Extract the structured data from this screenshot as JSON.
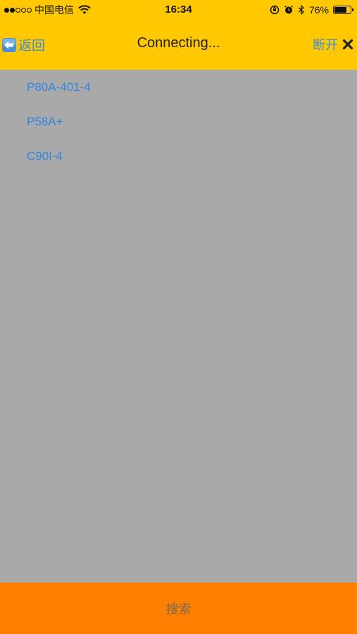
{
  "status_bar": {
    "carrier": "中国电信",
    "time": "16:34",
    "battery_percent": "76%",
    "battery_level": 0.76,
    "icons": [
      "signal-dots",
      "wifi-icon",
      "orientation-lock-icon",
      "alarm-icon",
      "bluetooth-icon",
      "battery-icon"
    ]
  },
  "nav": {
    "back_label": "返回",
    "title": "Connecting...",
    "disconnect_label": "断开"
  },
  "devices": [
    {
      "name": "P80A-401-4"
    },
    {
      "name": "P58A+"
    },
    {
      "name": "C90I-4"
    }
  ],
  "footer": {
    "search_label": "搜索"
  },
  "colors": {
    "header_bg": "#ffc800",
    "list_bg": "#a9a9a9",
    "footer_bg": "#ff8000",
    "link_blue": "#2f86e4"
  }
}
